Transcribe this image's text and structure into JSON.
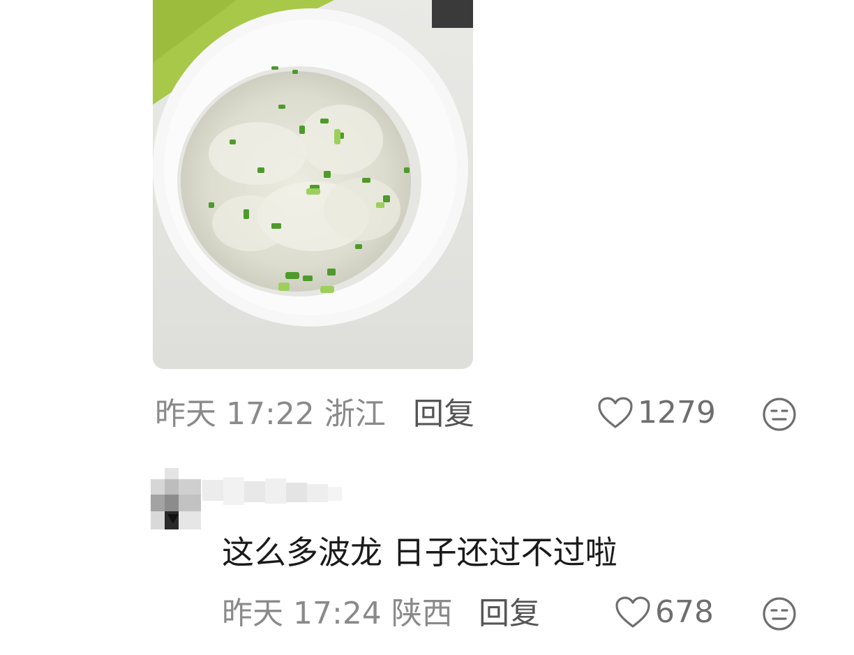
{
  "comments": [
    {
      "date_label": "昨天",
      "time": "17:22",
      "location": "浙江",
      "reply_label": "回复",
      "likes": "1279",
      "image": "bowl-of-wonton-soup-photo"
    },
    {
      "text": "这么多波龙 日子还过不过啦",
      "date_label": "昨天",
      "time": "17:24",
      "location": "陕西",
      "reply_label": "回复",
      "likes": "678"
    }
  ],
  "icons": {
    "like": "heart-outline-icon",
    "emoji": "neutral-face-icon"
  },
  "colors": {
    "meta_text": "#8a8a8a",
    "reply_text": "#555555",
    "comment_text": "#1a1a1a",
    "icon": "#6e6e6e"
  }
}
